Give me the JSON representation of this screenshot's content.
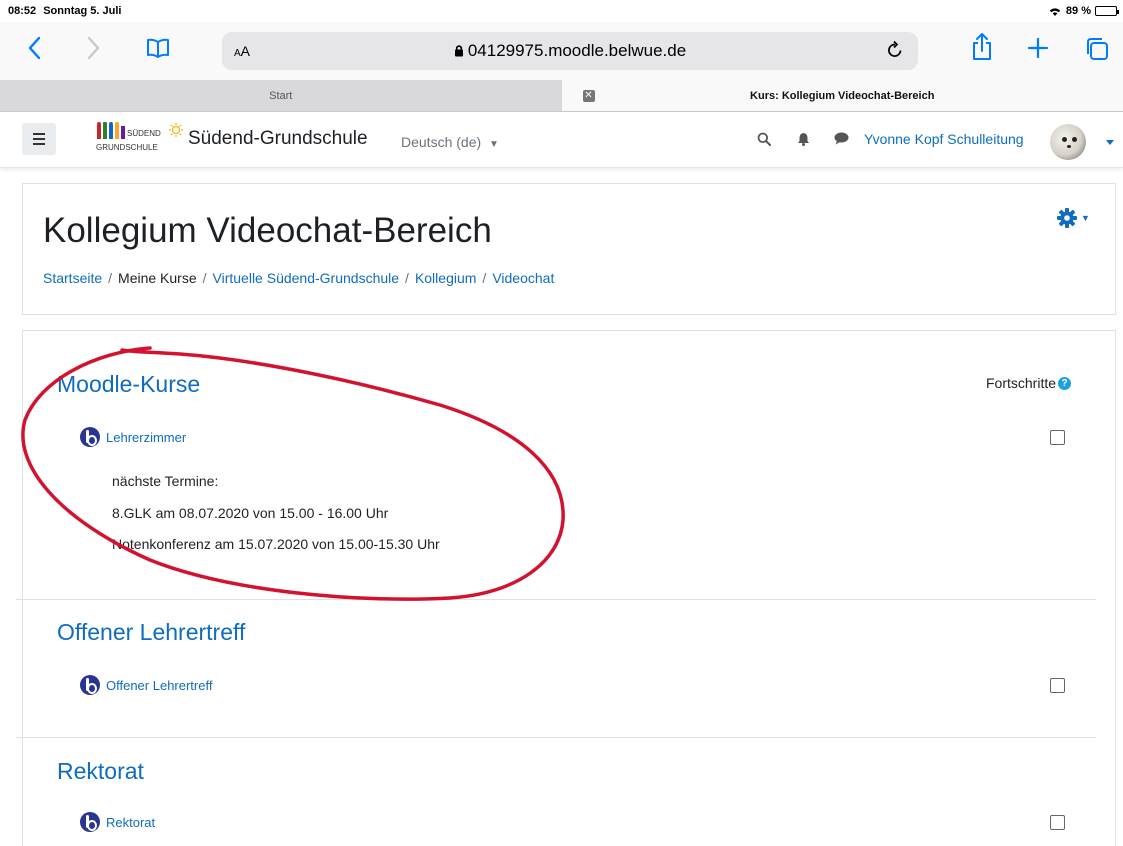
{
  "status_bar": {
    "time": "08:52",
    "date": "Sonntag 5. Juli",
    "battery": "89 %",
    "battery_level": 0.89
  },
  "browser": {
    "text_size_label": "AA",
    "url": "04129975.moodle.belwue.de",
    "tabs": [
      {
        "label": "Start",
        "active": false
      },
      {
        "label": "Kurs: Kollegium Videochat-Bereich",
        "active": true
      }
    ]
  },
  "navbar": {
    "site_name": "Südend-Grundschule",
    "logo_text_top": "SÜDEND",
    "logo_text_bottom": "GRUNDSCHULE",
    "language": "Deutsch (de)",
    "user_name": "Yvonne Kopf Schulleitung"
  },
  "page": {
    "title": "Kollegium Videochat-Bereich",
    "breadcrumb": [
      "Startseite",
      "Meine Kurse",
      "Virtuelle Südend-Grundschule",
      "Kollegium",
      "Videochat"
    ],
    "progress_label": "Fortschritte"
  },
  "sections": [
    {
      "title": "Moodle-Kurse",
      "activity": "Lehrerzimmer",
      "description": [
        "nächste Termine:",
        "8.GLK am 08.07.2020 von 15.00 - 16.00 Uhr",
        "Notenkonferenz am 15.07.2020 von 15.00-15.30 Uhr"
      ]
    },
    {
      "title": "Offener Lehrertreff",
      "activity": "Offener Lehrertreff"
    },
    {
      "title": "Rektorat",
      "activity": "Rektorat"
    }
  ],
  "colors": {
    "accent": "#0f6cbf",
    "safari_blue": "#007aff",
    "annotation_red": "#d2122e",
    "bbb_icon": "#283593"
  }
}
